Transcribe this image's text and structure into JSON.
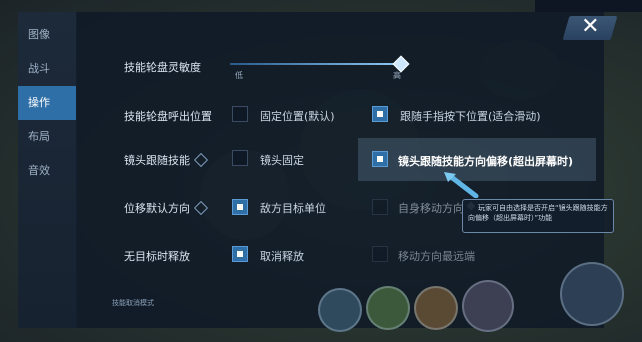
{
  "sidebar": {
    "items": [
      {
        "label": "图像",
        "active": false
      },
      {
        "label": "战斗",
        "active": false
      },
      {
        "label": "操作",
        "active": true
      },
      {
        "label": "布局",
        "active": false
      },
      {
        "label": "音效",
        "active": false
      }
    ]
  },
  "close_label": "✕",
  "settings": {
    "sensitivity": {
      "label": "技能轮盘灵敏度",
      "low": "低",
      "high": "高",
      "value_fraction": 0.97
    },
    "call_position": {
      "label": "技能轮盘呼出位置",
      "opt1": "固定位置(默认)",
      "opt2": "跟随手指按下位置(适合滑动)"
    },
    "camera_follow": {
      "label": "镜头跟随技能",
      "opt1": "镜头固定",
      "opt2": "镜头跟随技能方向偏移(超出屏幕时)"
    },
    "displace_dir": {
      "label": "位移默认方向",
      "opt1": "敌方目标单位",
      "opt2": "自身移动方向"
    },
    "no_target": {
      "label": "无目标时释放",
      "opt1": "取消释放",
      "opt2": "移动方向最远端"
    }
  },
  "tooltip": {
    "text": "玩家可自由选择是否开启“镜头跟随技能方向偏移（超出屏幕时）”功能"
  },
  "scroll_hint": "技能取消模式"
}
